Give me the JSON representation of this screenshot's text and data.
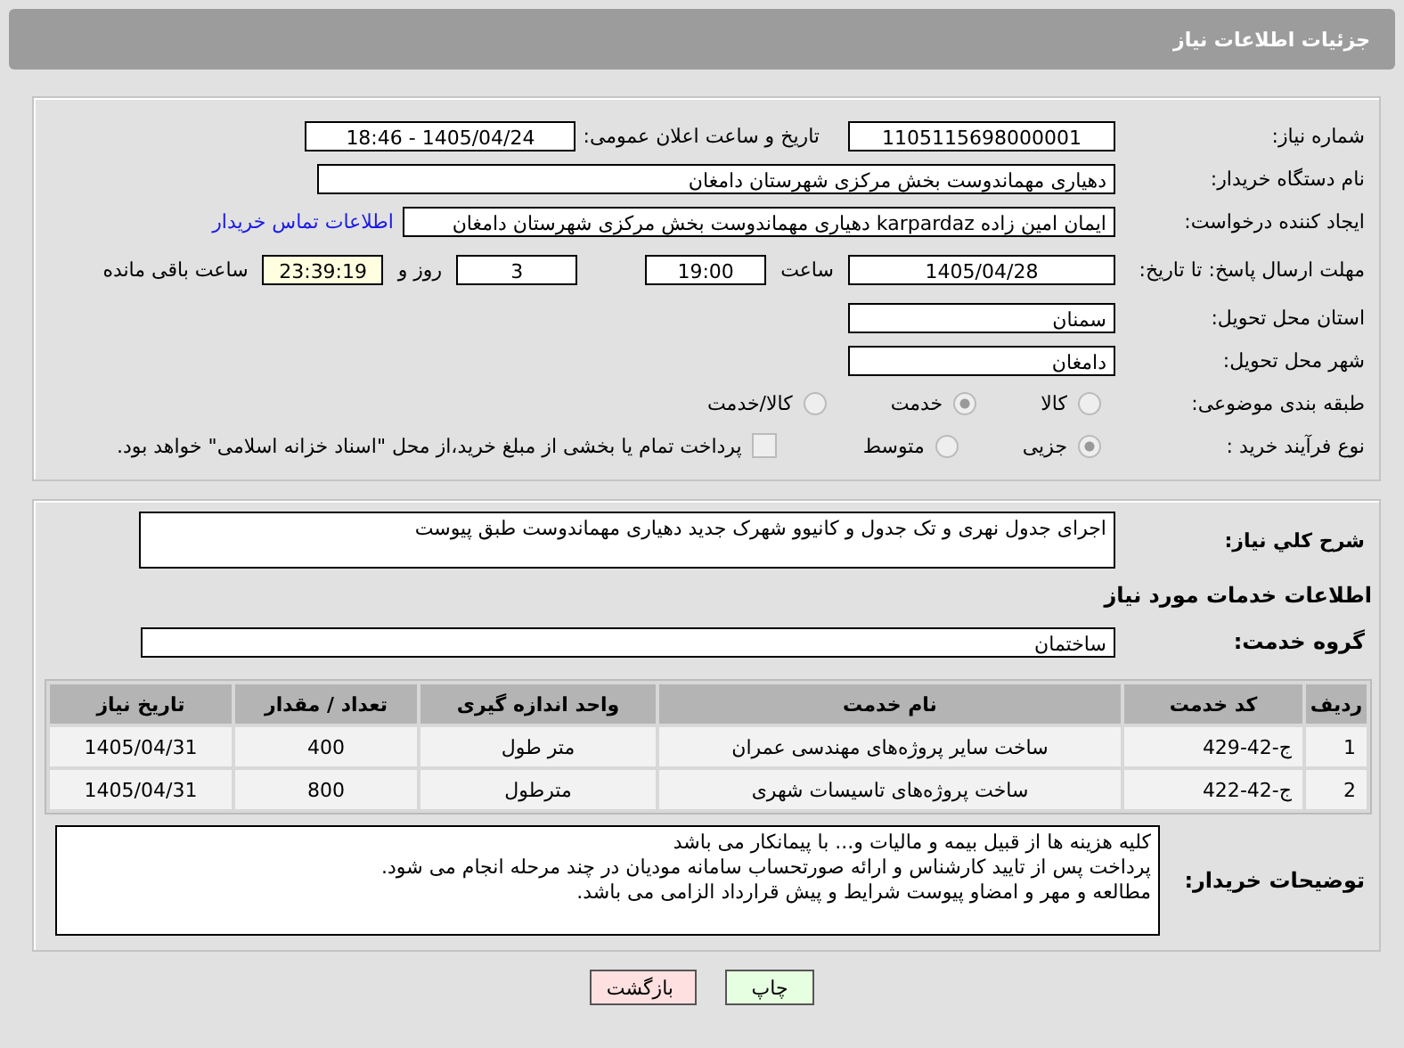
{
  "header": {
    "title": "جزئیات اطلاعات نیاز"
  },
  "need_number": {
    "label": "شماره نیاز:",
    "value": "1105115698000001"
  },
  "announce": {
    "label": "تاریخ و ساعت اعلان عمومی:",
    "value": "1405/04/24 - 18:46"
  },
  "buyer": {
    "label": "نام دستگاه خریدار:",
    "value": "دهیاری مهماندوست بخش مرکزی شهرستان دامغان"
  },
  "requester": {
    "label": "ایجاد کننده درخواست:",
    "value": "ایمان امین زاده karpardaz دهیاری مهماندوست بخش مرکزی شهرستان دامغان",
    "link": "اطلاعات تماس خریدار"
  },
  "deadline": {
    "label": "مهلت ارسال پاسخ: تا تاریخ:",
    "date": "1405/04/28",
    "time_label": "ساعت",
    "time": "19:00",
    "days": "3",
    "days_label": "روز و",
    "remaining": "23:39:19",
    "remaining_label": "ساعت باقی مانده"
  },
  "province": {
    "label": "استان محل تحویل:",
    "value": "سمنان"
  },
  "city": {
    "label": "شهر محل تحویل:",
    "value": "دامغان"
  },
  "category": {
    "label": "طبقه بندی موضوعی:",
    "options": [
      {
        "label": "کالا",
        "selected": false
      },
      {
        "label": "خدمت",
        "selected": true
      },
      {
        "label": "کالا/خدمت",
        "selected": false
      }
    ]
  },
  "process": {
    "label": "نوع فرآیند خرید :",
    "options": [
      {
        "label": "جزیی",
        "selected": true
      },
      {
        "label": "متوسط",
        "selected": false
      }
    ],
    "payment": {
      "checked": false,
      "text": "پرداخت تمام یا بخشی از مبلغ خرید،از محل \"اسناد خزانه اسلامی\" خواهد بود."
    }
  },
  "description": {
    "label": "شرح كلي نياز:",
    "value": "اجرای جدول نهری و تک جدول  و کانیوو شهرک جدید دهیاری مهماندوست طبق پیوست"
  },
  "services_title": "اطلاعات خدمات مورد نیاز",
  "service_group": {
    "label": "گروه خدمت:",
    "value": "ساختمان"
  },
  "table": {
    "columns": [
      "ردیف",
      "کد خدمت",
      "نام خدمت",
      "واحد اندازه گیری",
      "تعداد / مقدار",
      "تاریخ نیاز"
    ],
    "rows": [
      [
        "1",
        "ج-42-429",
        "ساخت سایر پروژه‌های مهندسی عمران",
        "متر طول",
        "400",
        "1405/04/31"
      ],
      [
        "2",
        "ج-42-422",
        "ساخت پروژه‌های تاسیسات شهری",
        "مترطول",
        "800",
        "1405/04/31"
      ]
    ]
  },
  "notes": {
    "label": "توضیحات خریدار:",
    "lines": [
      "کلیه هزینه ها از قبیل بیمه و مالیات و... با پیمانکار می باشد",
      "پرداخت پس از تایید کارشناس و ارائه صورتحساب سامانه مودیان در چند مرحله انجام می شود.",
      "مطالعه و مهر و امضاو پیوست شرایط و پیش قرارداد الزامی می باشد."
    ]
  },
  "buttons": [
    {
      "label": "چاپ",
      "kind": "print"
    },
    {
      "label": "بازگشت",
      "kind": "back"
    }
  ]
}
